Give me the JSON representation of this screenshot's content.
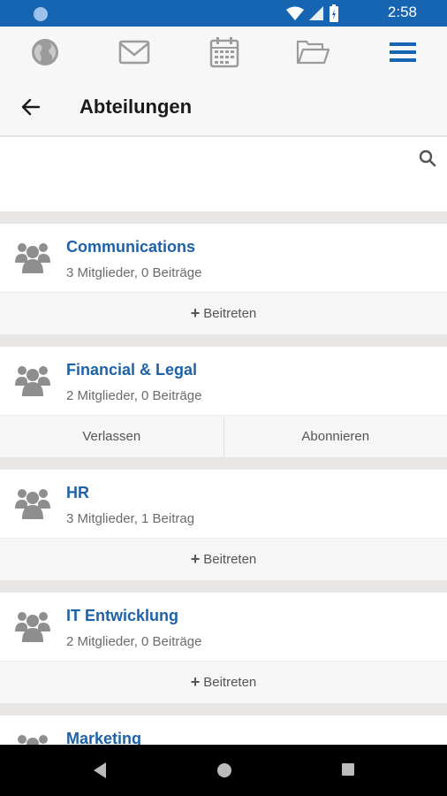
{
  "status_bar": {
    "time": "2:58"
  },
  "nav": {
    "items": [
      {
        "icon": "globe-icon"
      },
      {
        "icon": "mail-icon"
      },
      {
        "icon": "calendar-icon"
      },
      {
        "icon": "folder-icon"
      },
      {
        "icon": "menu-icon"
      }
    ]
  },
  "header": {
    "title": "Abteilungen"
  },
  "search": {
    "value": "",
    "placeholder": ""
  },
  "groups": [
    {
      "name": "Communications",
      "meta": "3 Mitglieder, 0 Beiträge",
      "actions": [
        "Beitreten"
      ],
      "primary_plus": true
    },
    {
      "name": "Financial & Legal",
      "meta": "2 Mitglieder, 0 Beiträge",
      "actions": [
        "Verlassen",
        "Abonnieren"
      ],
      "primary_plus": false
    },
    {
      "name": "HR",
      "meta": "3 Mitglieder, 1 Beitrag",
      "actions": [
        "Beitreten"
      ],
      "primary_plus": true
    },
    {
      "name": "IT Entwicklung",
      "meta": "2 Mitglieder, 0 Beiträge",
      "actions": [
        "Beitreten"
      ],
      "primary_plus": true
    },
    {
      "name": "Marketing",
      "meta": "",
      "actions": [],
      "primary_plus": false
    }
  ],
  "colors": {
    "accent": "#1565b3",
    "link": "#1d62a8"
  }
}
